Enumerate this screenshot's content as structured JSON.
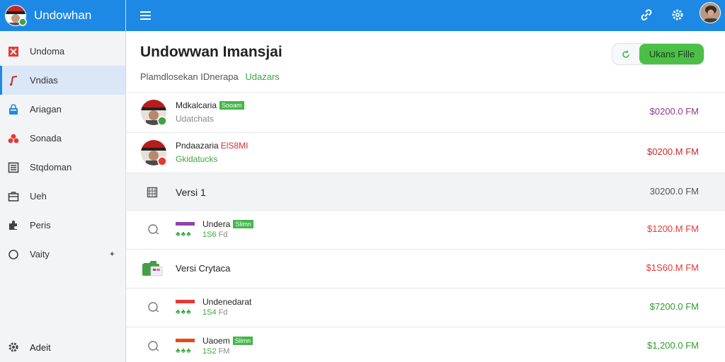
{
  "app": {
    "title": "Undowhan"
  },
  "sidebar": {
    "items": [
      {
        "label": "Undoma",
        "icon": "close-box-icon",
        "color": "#e53935",
        "active": false
      },
      {
        "label": "Vndias",
        "icon": "music-note-icon",
        "color": "#d32f2f",
        "active": true
      },
      {
        "label": "Ariagan",
        "icon": "lock-icon",
        "color": "#1e88e5",
        "active": false
      },
      {
        "label": "Sonada",
        "icon": "cluster-icon",
        "color": "#e53935",
        "active": false
      },
      {
        "label": "Stqdoman",
        "icon": "list-box-icon",
        "color": "#424242",
        "active": false
      },
      {
        "label": "Ueh",
        "icon": "briefcase-icon",
        "color": "#424242",
        "active": false
      },
      {
        "label": "Peris",
        "icon": "puzzle-icon",
        "color": "#424242",
        "active": false
      },
      {
        "label": "Vaity",
        "icon": "circle-icon",
        "color": "#424242",
        "active": false,
        "has_chevron": true
      }
    ],
    "footer": {
      "label": "Adeit",
      "icon": "gear-icon"
    }
  },
  "topbar": {
    "icons": [
      "menu-icon",
      "link-icon",
      "settings-icon",
      "user-avatar"
    ]
  },
  "main": {
    "title": "Undowwan Imansjai",
    "subtitle": "Plamdlosekan IDnerapa",
    "subtitle_highlight": "Udazars",
    "upload_button": "Ukans Fille",
    "rows": [
      {
        "kind": "user",
        "name": "Mdkalcaria",
        "badge": "Sooam",
        "sub": "Udatchats",
        "amount": "$0200.0 FM",
        "amount_color": "#8e3a8e",
        "status": "online"
      },
      {
        "kind": "user",
        "name": "Pndaazaria",
        "badge_text": "ElS8MI",
        "sub": "Gkidatucks",
        "amount": "$0200.M FM",
        "amount_color": "#c62828",
        "status": "blocked"
      },
      {
        "kind": "group",
        "label": "Versi 1",
        "amount": "30200.0 FM",
        "amount_color": "#555555",
        "icon": "abacus-icon"
      },
      {
        "kind": "child",
        "title": "Undera",
        "badge": "Slimn",
        "count": "1S6",
        "unit": "Fd",
        "amount": "$1200.M FM",
        "amount_color": "#e53935",
        "bar_color": "#8e44ad"
      },
      {
        "kind": "folder",
        "label": "Versi Crytaca",
        "amount": "$1S60.M FM",
        "amount_color": "#e53935",
        "icon": "folder-icon"
      },
      {
        "kind": "child",
        "title": "Undenedarat",
        "count": "1S4",
        "unit": "Fd",
        "amount": "$7200.0 FM",
        "amount_color": "#2e9b2e",
        "bar_color": "#e53935"
      },
      {
        "kind": "child",
        "title": "Uaoem",
        "badge": "Slimn",
        "count": "1S2",
        "unit": "FM",
        "amount": "$1,200.0 FM",
        "amount_color": "#2e9b2e",
        "bar_color": "#e64a19"
      }
    ]
  },
  "colors": {
    "accent": "#1e88e5",
    "success": "#4cbf47",
    "danger": "#e53935"
  }
}
